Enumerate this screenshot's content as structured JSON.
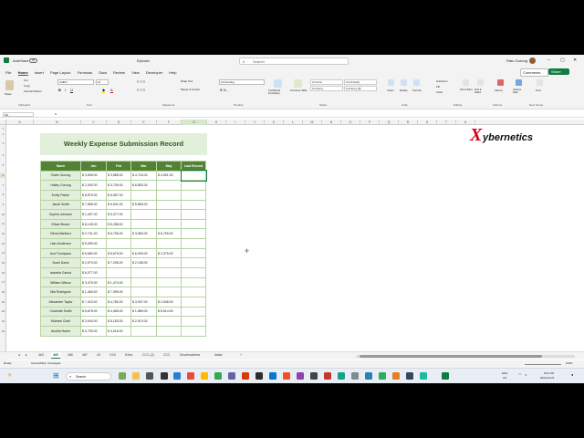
{
  "window": {
    "autosave": "AutoSave",
    "autosave_state": "Off",
    "filename": "Epicoric",
    "search_placeholder": "Search",
    "user": "Ratu Gurung"
  },
  "menu": {
    "items": [
      "File",
      "Home",
      "Insert",
      "Page Layout",
      "Formulas",
      "Data",
      "Review",
      "View",
      "Developer",
      "Help"
    ],
    "comments": "Comments",
    "share": "Share"
  },
  "ribbon": {
    "clipboard": {
      "paste": "Paste",
      "cut": "Cut",
      "copy": "Copy",
      "format_painter": "Format Painter",
      "label": "Clipboard"
    },
    "font": {
      "name": "Calibri",
      "size": "12",
      "label": "Font"
    },
    "alignment": {
      "wrap": "Wrap Text",
      "merge": "Merge & Center",
      "label": "Alignment"
    },
    "number": {
      "format": "Accounting",
      "label": "Number"
    },
    "styles": {
      "conditional": "Conditional Formatting",
      "format_table": "Format as Table",
      "comma": "Comma",
      "comma0": "Comma [0]",
      "currency": "Currency",
      "currency0": "Currency [0]",
      "label": "Styles"
    },
    "cells": {
      "insert": "Insert",
      "delete": "Delete",
      "format": "Format",
      "label": "Cells"
    },
    "editing": {
      "autosum": "AutoSum",
      "fill": "Fill",
      "clear": "Clear",
      "sort": "Sort & Filter",
      "find": "Find & Select",
      "label": "Editing"
    },
    "addins": {
      "addins": "Add-ins",
      "analyze": "Analyze Data",
      "form": "Form",
      "label": "Add-ins"
    },
    "new_group": {
      "label": "New Group"
    }
  },
  "formula_bar": {
    "name_box": "G6",
    "fx": "fx",
    "content": ""
  },
  "columns": [
    "A",
    "B",
    "C",
    "D",
    "E",
    "F",
    "G",
    "H",
    "I",
    "J",
    "K",
    "L",
    "M",
    "N",
    "O",
    "P",
    "Q",
    "R",
    "S",
    "T",
    "U"
  ],
  "rows": [
    "1",
    "2",
    "3",
    "4",
    "5",
    "6",
    "7",
    "8",
    "9",
    "10",
    "11",
    "12",
    "13",
    "14",
    "15",
    "16",
    "17",
    "18",
    "19",
    "20",
    "21",
    "22"
  ],
  "logo": {
    "text": "ybernetics"
  },
  "sheet": {
    "title": "Weekly Expense Submission Record",
    "headers": [
      "Name",
      "Jan",
      "Feb",
      "Mar",
      "May",
      "Last Record"
    ],
    "rows": [
      [
        "Claire Gurung",
        "$ 3,606.00",
        "$ 3,885.00",
        "$ 4,744.00",
        "$ 4,051.00",
        ""
      ],
      [
        "Hailey Gurung",
        "$ 2,090.00",
        "$ 3,705.00",
        "$ 8,852.00",
        "",
        ""
      ],
      [
        "Emily Parker",
        "$ 8,579.00",
        "$ 6,557.00",
        "",
        "",
        ""
      ],
      [
        "Jacob Smith",
        "$ 7,965.00",
        "$ 6,941.00",
        "$ 5,883.00",
        "",
        ""
      ],
      [
        "Sophia Johnson",
        "$ 1,497.00",
        "$ 5,377.00",
        "",
        "",
        ""
      ],
      [
        "Ethan Brown",
        "$ 8,145.00",
        "$ 5,258.00",
        "",
        "",
        ""
      ],
      [
        "Olivia Martinez",
        "$ 2,741.00",
        "$ 6,706.00",
        "$ 3,560.00",
        "$ 8,759.00",
        ""
      ],
      [
        "Liam Anderson",
        "$ 5,059.00",
        "",
        "",
        "",
        ""
      ],
      [
        "Ava Thompson",
        "$ 5,683.00",
        "$ 8,679.00",
        "$ 6,099.00",
        "$ 2,075.00",
        ""
      ],
      [
        "Noah Davis",
        "$ 2,973.00",
        "$ 7,206.00",
        "$ 2,158.00",
        "",
        ""
      ],
      [
        "Isabella Garcia",
        "$ 6,077.00",
        "",
        "",
        "",
        ""
      ],
      [
        "William Wilson",
        "$ 3,479.00",
        "$ 1,474.00",
        "",
        "",
        ""
      ],
      [
        "Mia Rodriguez",
        "$ 1,463.00",
        "$ 7,099.00",
        "",
        "",
        ""
      ],
      [
        "Alexander Taylor",
        "$ 7,410.00",
        "$ 4,780.00",
        "$ 3,937.00",
        "$ 2,548.00",
        ""
      ],
      [
        "Charlotte Smith",
        "$ 5,675.00",
        "$ 4,465.00",
        "$ 1,889.00",
        "$ 8,514.00",
        ""
      ],
      [
        "Michael Clark",
        "$ 3,943.00",
        "$ 8,183.00",
        "$ 2,913.00",
        "",
        ""
      ],
      [
        "Amelia Harris",
        "$ 5,703.00",
        "$ 4,016.00",
        "",
        "",
        ""
      ]
    ]
  },
  "sheet_tabs": [
    "463",
    "465",
    "466",
    "467",
    "43",
    "XXX",
    "Extra",
    "CCC (2)",
    "CCC",
    "Smartwatches",
    "datas"
  ],
  "active_tab": "465",
  "status": {
    "ready": "Ready",
    "accessibility": "Accessibility: Investigate",
    "zoom": "100%"
  },
  "taskbar": {
    "search": "Search",
    "lang": "ENG",
    "lang2": "US",
    "time": "8:21 PM",
    "date": "2024-03-23"
  }
}
